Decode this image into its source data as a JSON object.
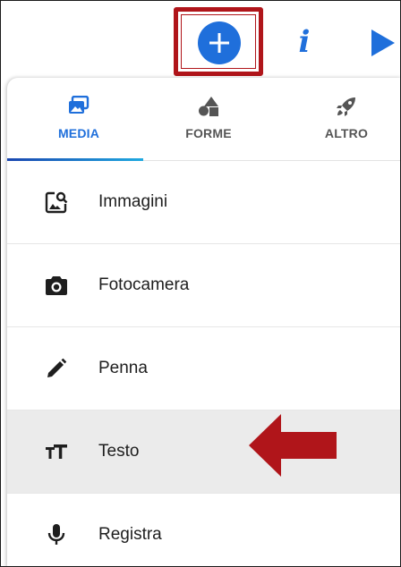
{
  "toolbar": {
    "add_icon": "plus-icon",
    "info_icon": "info-icon",
    "info_glyph": "i",
    "play_icon": "play-icon"
  },
  "tabs": [
    {
      "label": "MEDIA",
      "icon": "media-icon",
      "active": true
    },
    {
      "label": "FORME",
      "icon": "shapes-icon",
      "active": false
    },
    {
      "label": "ALTRO",
      "icon": "rocket-icon",
      "active": false
    }
  ],
  "menu": [
    {
      "label": "Immagini",
      "icon": "image-search-icon"
    },
    {
      "label": "Fotocamera",
      "icon": "camera-icon"
    },
    {
      "label": "Penna",
      "icon": "pen-icon"
    },
    {
      "label": "Testo",
      "icon": "text-size-icon",
      "selected": true
    },
    {
      "label": "Registra",
      "icon": "microphone-icon"
    }
  ],
  "colors": {
    "accent": "#1f6fdb",
    "highlight": "#b0151a",
    "selected_row": "#ebebeb"
  }
}
